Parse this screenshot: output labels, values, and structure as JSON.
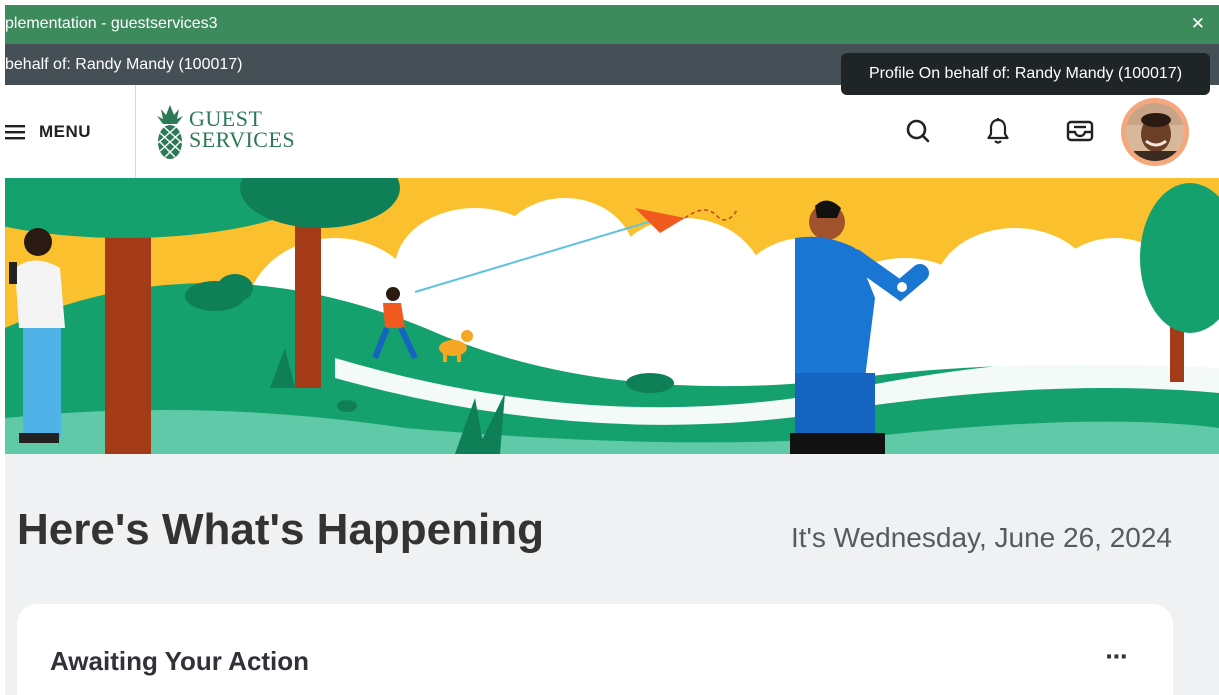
{
  "impl_bar": {
    "title": "plementation - guestservices3",
    "close_glyph": "✕"
  },
  "behalf_bar": {
    "text": "behalf of: Randy Mandy (100017)"
  },
  "tooltip": {
    "text": "Profile On behalf of: Randy Mandy (100017)"
  },
  "header": {
    "menu_label": "MENU",
    "logo": {
      "line1": "GUEST",
      "line2": "SERVICES"
    },
    "icons": [
      "search-icon",
      "bell-icon",
      "inbox-icon"
    ],
    "avatar": "profile-avatar"
  },
  "main": {
    "heading": "Here's What's Happening",
    "date": "It's Wednesday, June 26, 2024"
  },
  "card": {
    "title": "Awaiting Your Action",
    "more": "⋯"
  },
  "colors": {
    "impl_bar": "#3d8a5d",
    "behalf_bar": "#444f56",
    "tooltip": "#1f2427",
    "brand_green": "#2c7a55",
    "sky": "#fbc02d",
    "grass": "#15a16e",
    "avatar_ring": "#f4a77c"
  }
}
